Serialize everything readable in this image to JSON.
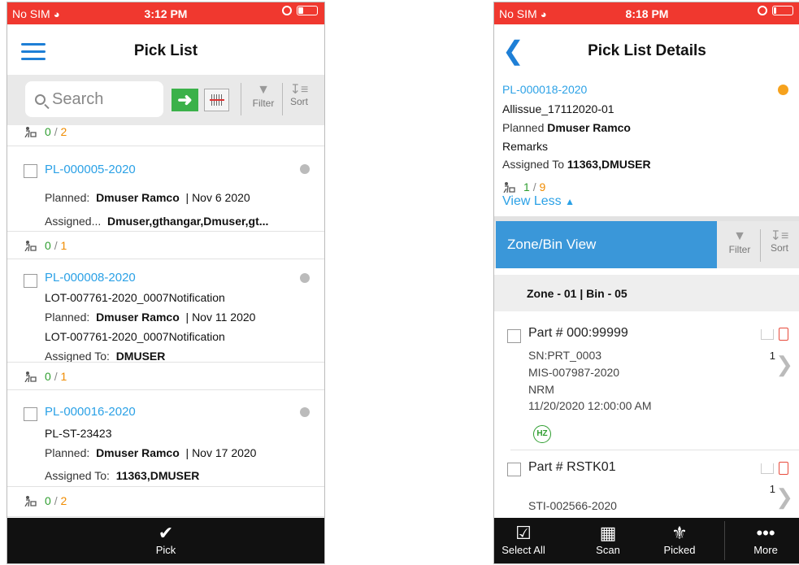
{
  "left_screen": {
    "status": {
      "carrier": "No SIM",
      "time": "3:12 PM"
    },
    "title": "Pick List",
    "search": {
      "placeholder": "Search",
      "filter_label": "Filter",
      "sort_label": "Sort"
    },
    "top_partial_count": {
      "picked": "0",
      "sep": "/",
      "total": "2"
    },
    "items": [
      {
        "id": "PL-000005-2020",
        "lines": [
          {
            "k": "Planned:",
            "v": "Dmuser Ramco",
            "extra": "| Nov  6 2020"
          },
          {
            "k": "Assigned...",
            "v": "Dmuser,gthangar,Dmuser,gt...",
            "extra": ""
          }
        ],
        "picked": "0",
        "sep": "/",
        "total": "1"
      },
      {
        "id": "PL-000008-2020",
        "lines": [
          {
            "k": "LOT-007761-2020_0007Notification",
            "v": "",
            "extra": ""
          },
          {
            "k": "Planned:",
            "v": "Dmuser Ramco",
            "extra": "| Nov 11 2020"
          },
          {
            "k": "LOT-007761-2020_0007Notification",
            "v": "",
            "extra": ""
          },
          {
            "k": "Assigned To:",
            "v": "DMUSER",
            "extra": ""
          }
        ],
        "picked": "0",
        "sep": "/",
        "total": "1"
      },
      {
        "id": "PL-000016-2020",
        "lines": [
          {
            "k": "PL-ST-23423",
            "v": "",
            "extra": ""
          },
          {
            "k": "Planned:",
            "v": "Dmuser Ramco",
            "extra": "| Nov 17 2020"
          },
          {
            "k": "Assigned To:",
            "v": "11363,DMUSER",
            "extra": ""
          }
        ],
        "picked": "0",
        "sep": "/",
        "total": "2"
      }
    ],
    "bottom": {
      "pick_label": "Pick"
    }
  },
  "right_screen": {
    "status": {
      "carrier": "No SIM",
      "time": "8:18 PM"
    },
    "title": "Pick List Details",
    "detail": {
      "id": "PL-000018-2020",
      "name": "Allissue_17112020-01",
      "planned_k": "Planned",
      "planned_v": "Dmuser Ramco",
      "remarks": "Remarks",
      "assigned_k": "Assigned To",
      "assigned_v": "11363,DMUSER",
      "picked": "1",
      "sep": "/",
      "total": "9",
      "view_less": "View Less"
    },
    "zone_view_label": "Zone/Bin View",
    "filter_label": "Filter",
    "sort_label": "Sort",
    "zone_header": "Zone  - 01 | Bin  - 05",
    "parts": [
      {
        "name": "Part # 000:99999",
        "lines": [
          "SN:PRT_0003",
          "MIS-007987-2020",
          "NRM",
          "11/20/2020 12:00:00 AM"
        ],
        "qty": "1",
        "badge": "HZ"
      },
      {
        "name": "Part # RSTK01",
        "lines": [
          "",
          "STI-002566-2020"
        ],
        "qty": "1",
        "badge": ""
      }
    ],
    "bottom": [
      {
        "label": "Select All",
        "icon": "select-all-icon"
      },
      {
        "label": "Scan",
        "icon": "scan-icon"
      },
      {
        "label": "Picked",
        "icon": "picked-icon"
      },
      {
        "label": "More",
        "icon": "more-icon"
      }
    ]
  },
  "colors": {
    "status_red": "#f0382f",
    "link_blue": "#2ba1e6",
    "accent_blue": "#3a97d9",
    "green": "#2f9e30",
    "orange": "#f08b00"
  }
}
